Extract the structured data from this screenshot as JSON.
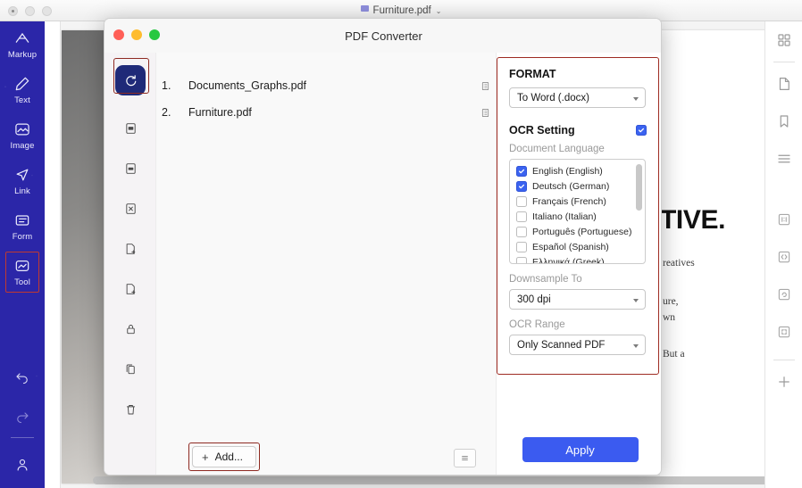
{
  "os_window": {
    "title": "Furniture.pdf",
    "chevron": "⌄"
  },
  "left_nav": {
    "items": [
      {
        "label": "Markup",
        "icon": "markup-icon",
        "selected": false
      },
      {
        "label": "Text",
        "icon": "pencil-icon",
        "selected": false
      },
      {
        "label": "Image",
        "icon": "image-icon",
        "selected": false
      },
      {
        "label": "Link",
        "icon": "link-send-icon",
        "selected": false
      },
      {
        "label": "Form",
        "icon": "form-icon",
        "selected": false
      },
      {
        "label": "Tool",
        "icon": "tool-icon",
        "selected": true
      }
    ],
    "bottom_icons": [
      {
        "icon": "undo-icon"
      },
      {
        "icon": "redo-icon"
      },
      {
        "icon": "account-icon"
      }
    ]
  },
  "document": {
    "headline": "TIVE.",
    "line1": "reatives",
    "line2": "ure,",
    "line3": "wn",
    "line4": "But a"
  },
  "right_rail": {
    "items": [
      {
        "icon": "grid-thumbnails-icon"
      },
      {
        "icon": "page-icon"
      },
      {
        "icon": "bookmark-icon"
      },
      {
        "icon": "outline-list-icon"
      },
      {
        "icon": "fit-one-to-one-icon"
      },
      {
        "icon": "fit-width-icon"
      },
      {
        "icon": "rotate-page-icon"
      },
      {
        "icon": "crop-page-icon"
      },
      {
        "icon": "add-plus-icon"
      }
    ]
  },
  "dialog": {
    "title": "PDF Converter",
    "traffic_lights": [
      "close",
      "minimize",
      "maximize"
    ],
    "strip": [
      {
        "icon": "convert-refresh-icon",
        "active": true
      },
      {
        "icon": "to-word-doc-icon",
        "active": false
      },
      {
        "icon": "to-ppt-doc-icon",
        "active": false
      },
      {
        "icon": "to-excel-doc-icon",
        "active": false
      },
      {
        "icon": "insert-page-icon",
        "active": false
      },
      {
        "icon": "extract-page-icon",
        "active": false
      },
      {
        "icon": "lock-protect-icon",
        "active": false
      },
      {
        "icon": "duplicate-copy-icon",
        "active": false
      },
      {
        "icon": "trash-delete-icon",
        "active": false
      }
    ],
    "files": [
      {
        "number": "1.",
        "name": "Documents_Graphs.pdf",
        "icon": "page-range-icon"
      },
      {
        "number": "2.",
        "name": "Furniture.pdf",
        "icon": "page-range-icon"
      }
    ],
    "footer": {
      "add_label": "Add...",
      "add_plus": "+",
      "list_mode_icon": "list-view-icon"
    },
    "panel": {
      "format_heading": "FORMAT",
      "format_value": "To Word (.docx)",
      "ocr_heading": "OCR Setting",
      "ocr_enabled": true,
      "language_label": "Document Language",
      "languages": [
        {
          "label": "English (English)",
          "checked": true
        },
        {
          "label": "Deutsch (German)",
          "checked": true
        },
        {
          "label": "Français (French)",
          "checked": false
        },
        {
          "label": "Italiano (Italian)",
          "checked": false
        },
        {
          "label": "Português (Portuguese)",
          "checked": false
        },
        {
          "label": "Español (Spanish)",
          "checked": false
        },
        {
          "label": "Ελληνικά (Greek)",
          "checked": false
        }
      ],
      "downsample_label": "Downsample To",
      "downsample_value": "300 dpi",
      "ocr_range_label": "OCR Range",
      "ocr_range_value": "Only Scanned PDF",
      "apply_label": "Apply"
    }
  },
  "colors": {
    "nav_blue": "#2b26a8",
    "accent_blue": "#3b5bf0",
    "highlight_red": "#9e2b22",
    "strip_active": "#1f2a78"
  }
}
